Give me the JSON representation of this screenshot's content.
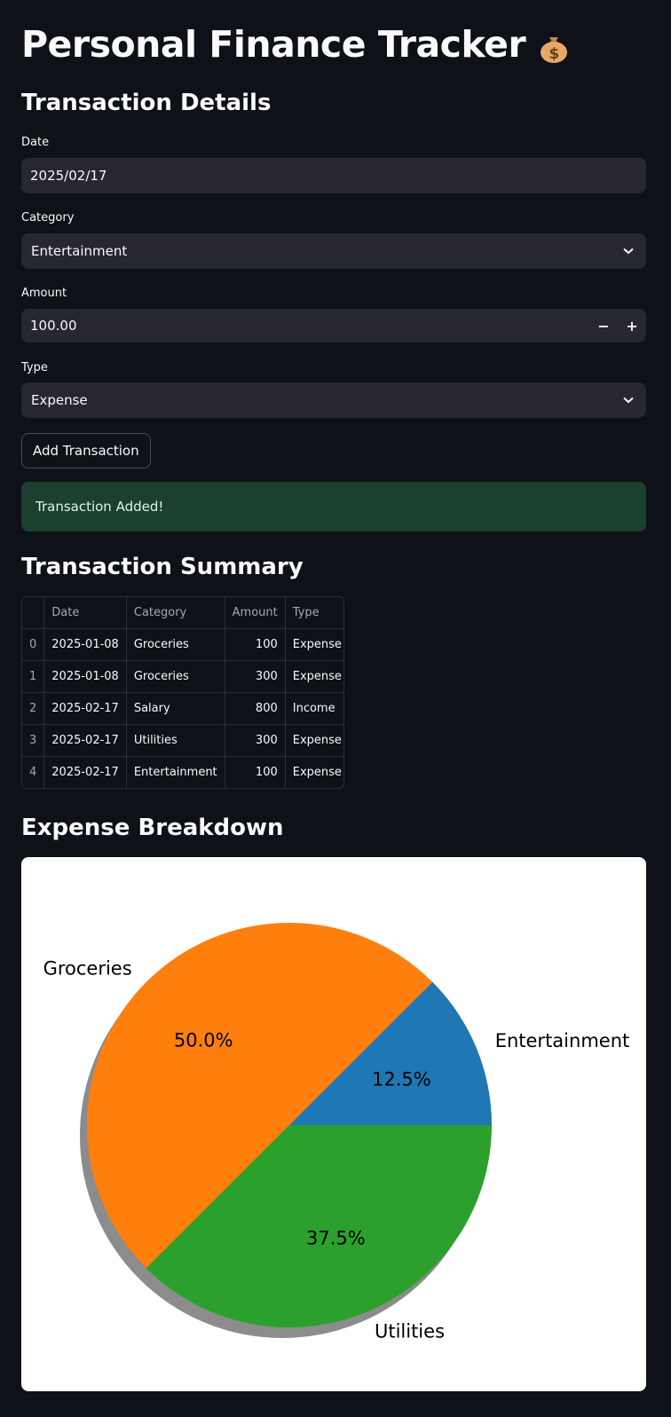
{
  "page": {
    "title": "Personal Finance Tracker",
    "title_icon": "money-bag-icon"
  },
  "transaction_details": {
    "heading": "Transaction Details",
    "date": {
      "label": "Date",
      "value": "2025/02/17"
    },
    "category": {
      "label": "Category",
      "value": "Entertainment"
    },
    "amount": {
      "label": "Amount",
      "value": "100.00",
      "decrement": "−",
      "increment": "+"
    },
    "type": {
      "label": "Type",
      "value": "Expense"
    },
    "add_button": "Add Transaction",
    "success_message": "Transaction Added!"
  },
  "summary": {
    "heading": "Transaction Summary",
    "columns": [
      "",
      "Date",
      "Category",
      "Amount",
      "Type"
    ],
    "rows": [
      {
        "index": "0",
        "date": "2025-01-08",
        "category": "Groceries",
        "amount": "100",
        "type": "Expense"
      },
      {
        "index": "1",
        "date": "2025-01-08",
        "category": "Groceries",
        "amount": "300",
        "type": "Expense"
      },
      {
        "index": "2",
        "date": "2025-02-17",
        "category": "Salary",
        "amount": "800",
        "type": "Income"
      },
      {
        "index": "3",
        "date": "2025-02-17",
        "category": "Utilities",
        "amount": "300",
        "type": "Expense"
      },
      {
        "index": "4",
        "date": "2025-02-17",
        "category": "Entertainment",
        "amount": "100",
        "type": "Expense"
      }
    ]
  },
  "expense_breakdown": {
    "heading": "Expense Breakdown"
  },
  "colors": {
    "background": "#0e1117",
    "input_bg": "#262730",
    "success_bg": "#1c4030",
    "entertainment": "#1f77b4",
    "groceries": "#ff7f0e",
    "utilities": "#2ca02c"
  },
  "chart_data": {
    "type": "pie",
    "categories": [
      "Entertainment",
      "Groceries",
      "Utilities"
    ],
    "values": [
      100,
      400,
      300
    ],
    "percent_labels": [
      "12.5%",
      "50.0%",
      "37.5%"
    ],
    "colors": [
      "#1f77b4",
      "#ff7f0e",
      "#2ca02c"
    ],
    "start_angle_deg": 0,
    "shadow": true
  }
}
